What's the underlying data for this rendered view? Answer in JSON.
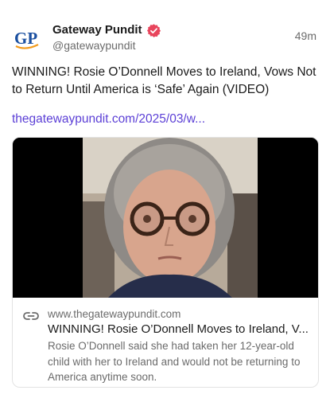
{
  "post": {
    "author": {
      "display_name": "Gateway Pundit",
      "handle": "@gatewaypundit",
      "avatar_text": "GP",
      "verified_icon": "verified-badge-icon",
      "verified_color": "#e8455c"
    },
    "timestamp": "49m",
    "text": "WINNING! Rosie O’Donnell Moves to Ireland, Vows Not to Return Until America is ‘Safe’ Again (VIDEO)",
    "link_text": "thegatewaypundit.com/2025/03/w...",
    "link_color": "#5b3fd6"
  },
  "card": {
    "link_icon": "link-icon",
    "domain": "www.thegatewaypundit.com",
    "title": "WINNING! Rosie O’Donnell Moves to Ireland, V...",
    "description": "Rosie O’Donnell said she had taken her 12-year-old child with her to Ireland and would not be returning to America anytime soon."
  },
  "colors": {
    "text": "#1a1a1a",
    "muted": "#6b6b6b",
    "brand_blue": "#1a4fa0",
    "brand_orange": "#f29b1d"
  }
}
